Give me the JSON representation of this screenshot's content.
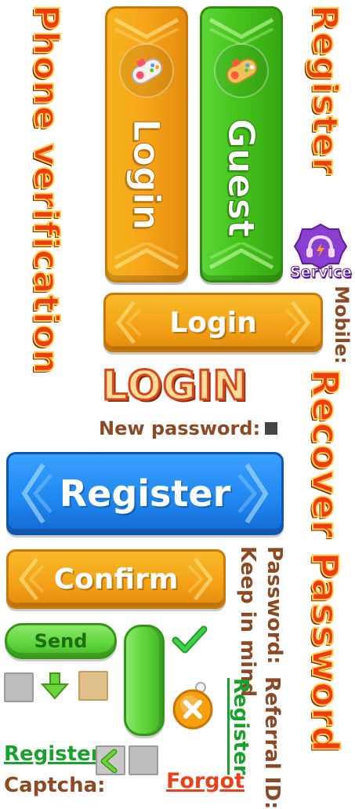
{
  "titles": {
    "phone_verification": "Phone verification",
    "register": "Register",
    "recover_password": "Recover Password",
    "login_logo": "LOGIN"
  },
  "tall_buttons": {
    "login": "Login",
    "guest": "Guest"
  },
  "service": {
    "label": "Service"
  },
  "buttons": {
    "login": "Login",
    "register": "Register",
    "confirm": "Confirm",
    "send": "Send"
  },
  "labels": {
    "mobile": "Mobile:",
    "new_password": "New password:",
    "password": "Password:",
    "keep_in_mind": "Keep in mind",
    "referral_id": "Referral ID:",
    "captcha": "Captcha:"
  },
  "links": {
    "register_vertical": "Register",
    "register": "Register",
    "forgot": "Forgot"
  },
  "colors": {
    "orange": "#f7a619",
    "green": "#45c41c",
    "blue": "#1f86f0",
    "title_red": "#f03a12",
    "label_brown": "#8b4a24"
  },
  "icons": [
    "gamepad-icon",
    "headset-icon",
    "check-icon",
    "down-arrow-icon",
    "back-arrow-icon",
    "close-icon"
  ]
}
